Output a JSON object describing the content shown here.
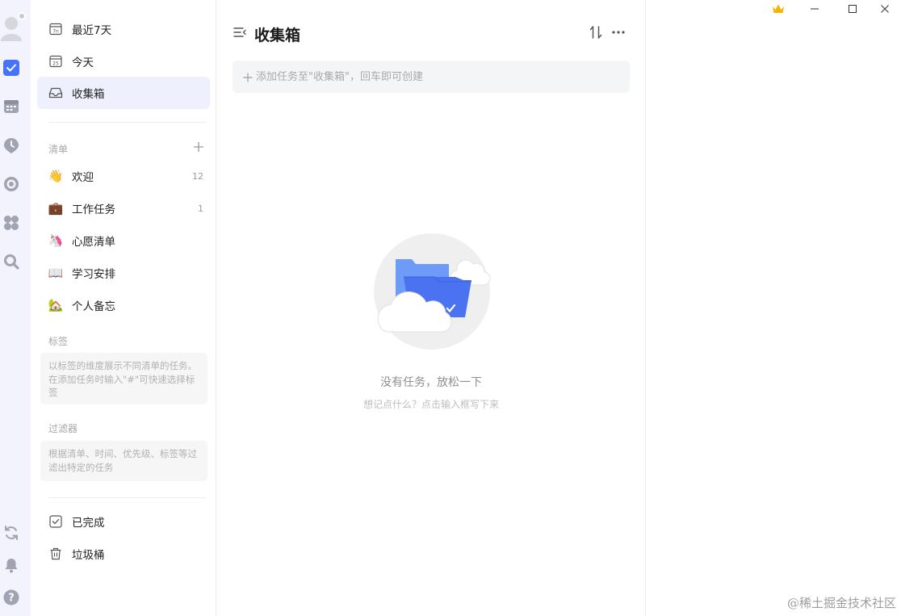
{
  "app": {
    "accent": "#4772fa"
  },
  "rail": {
    "icons": [
      "avatar-icon",
      "task-checkbox-icon",
      "calendar-icon",
      "pomodoro-icon",
      "habit-icon",
      "apps-icon",
      "search-icon",
      "sync-icon",
      "notification-bell-icon",
      "help-icon"
    ]
  },
  "sidebar": {
    "smart_lists": [
      {
        "label": "最近7天",
        "icon": "next-7-days-icon"
      },
      {
        "label": "今天",
        "icon": "today-icon"
      },
      {
        "label": "收集箱",
        "icon": "inbox-icon",
        "active": true
      }
    ],
    "lists_title": "清单",
    "lists": [
      {
        "emoji": "👋",
        "label": "欢迎",
        "count": "12"
      },
      {
        "emoji": "💼",
        "label": "工作任务",
        "count": "1"
      },
      {
        "emoji": "🦄",
        "label": "心愿清单",
        "count": ""
      },
      {
        "emoji": "📖",
        "label": "学习安排",
        "count": ""
      },
      {
        "emoji": "🏡",
        "label": "个人备忘",
        "count": ""
      }
    ],
    "tags_title": "标签",
    "tags_hint": "以标签的维度展示不同清单的任务。在添加任务时输入\"#\"可快速选择标签",
    "filters_title": "过滤器",
    "filters_hint": "根据清单、时间、优先级、标签等过滤出特定的任务",
    "footer": [
      {
        "label": "已完成",
        "icon": "completed-icon"
      },
      {
        "label": "垃圾桶",
        "icon": "trash-icon"
      }
    ]
  },
  "main": {
    "title": "收集箱",
    "add_task_placeholder": "添加任务至\"收集箱\"，回车即可创建",
    "empty_title": "没有任务，放松一下",
    "empty_subtitle": "想记点什么？点击输入框写下来"
  },
  "window": {
    "controls": [
      "premium-crown-icon",
      "minimize-icon",
      "maximize-icon",
      "close-icon"
    ],
    "crown_color": "#f5b400"
  },
  "watermark": "@稀土掘金技术社区"
}
